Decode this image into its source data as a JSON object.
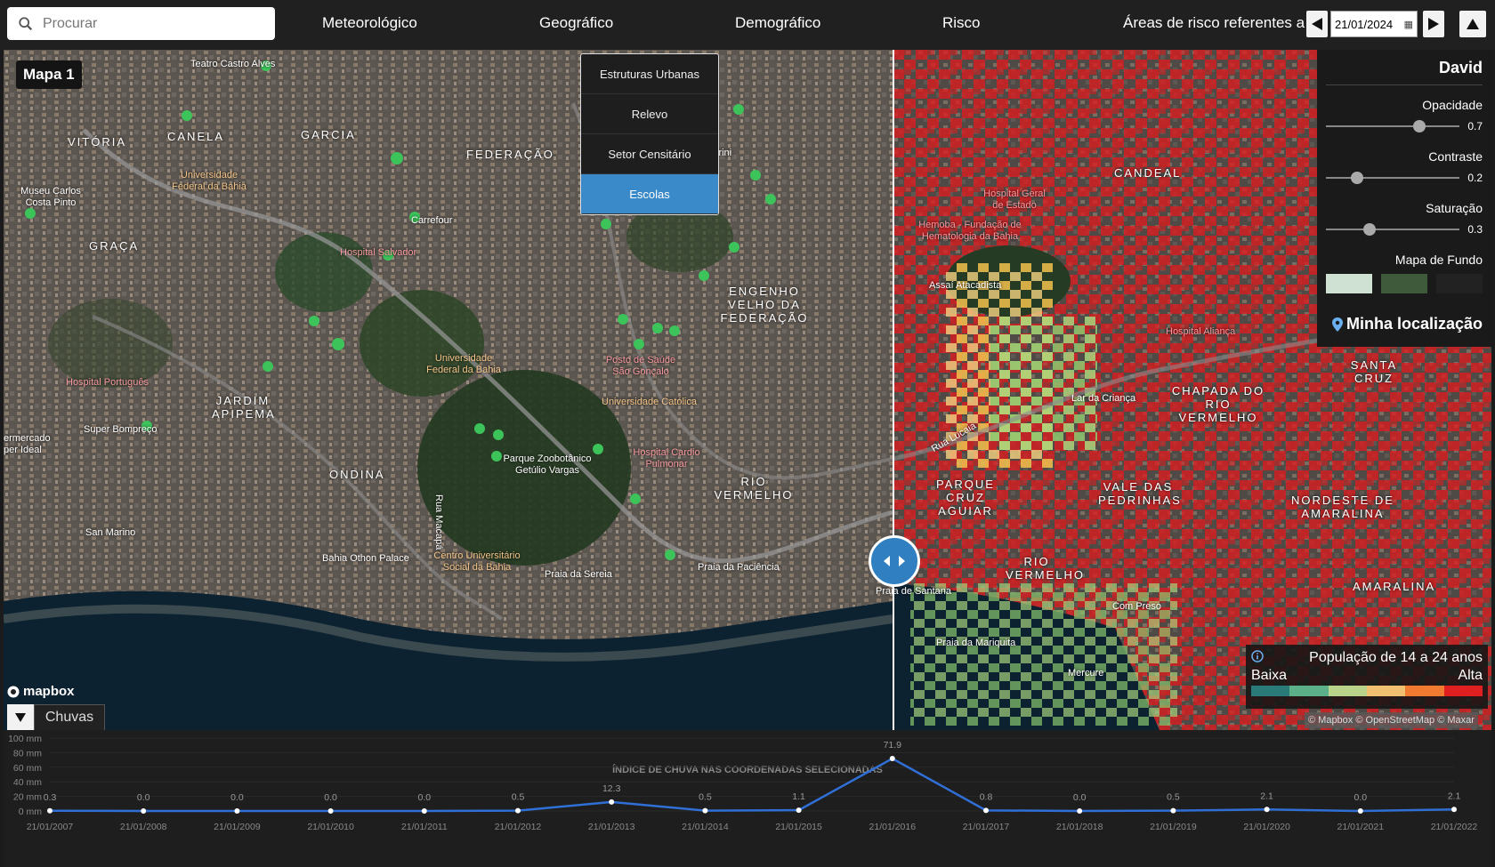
{
  "search": {
    "placeholder": "Procurar"
  },
  "nav": [
    "Meteorológico",
    "Geográfico",
    "Demográfico",
    "Risco"
  ],
  "risk": {
    "label": "Áreas de risco referentes a",
    "date": "21/01/2024"
  },
  "dropdown": {
    "options": [
      "Estruturas Urbanas",
      "Relevo",
      "Setor Censitário",
      "Escolas"
    ],
    "selected": "Escolas"
  },
  "map": {
    "title": "Mapa 1",
    "attribution": "© Mapbox © OpenStreetMap © Maxar",
    "brand": "mapbox",
    "labels_left": [
      "VITÓRIA",
      "CANELA",
      "GARCIA",
      "FEDERAÇÃO",
      "GRAÇA",
      "ENGENHO VELHO DA FEDERAÇÃO",
      "JARDIM APIPEMA",
      "ONDINA",
      "RIO VERMELHO",
      "Teatro Castro Alves",
      "Universidade Federal da Bahia",
      "Museu Carlos Costa Pinto",
      "Carrefour",
      "Hospital Salvador",
      "Perini",
      "Hospital Português",
      "Super Bompreço",
      "ermercado per Ideal",
      "San Marino",
      "Universidade Federal da Bahia",
      "Posto de Saúde São Gonçalo",
      "Universidade Católica",
      "Parque Zoobotânico Getúlio Vargas",
      "Hospital Cardio Pulmonar",
      "Bahia Othon Palace",
      "Centro Universitário Social da Bahia",
      "Praia da Sereia",
      "Praia da Paciência",
      "Rua Macapá"
    ],
    "labels_right": [
      "CANDEAL",
      "Hospital Geral de Estado",
      "Hemoba - Fundação de Hematologia da Bahia",
      "Assaí Atacadista",
      "Hospital Aliança",
      "SANTA CRUZ",
      "CHAPADA DO RIO VERMELHO",
      "Lar da Criança",
      "PARQUE CRUZ AGUIAR",
      "VALE DAS PEDRINHAS",
      "NORDESTE DE AMARALINA",
      "RIO VERMELHO",
      "AMARALINA",
      "Praia de Santana",
      "Com Preso",
      "Praia da Mariquita",
      "Mercure",
      "Rua Lucaia"
    ]
  },
  "panel": {
    "user": "David",
    "opacity": {
      "label": "Opacidade",
      "value": 0.7
    },
    "contrast": {
      "label": "Contraste",
      "value": 0.2
    },
    "saturation": {
      "label": "Saturação",
      "value": 0.3
    },
    "basemap_label": "Mapa de Fundo",
    "location_label": "Minha localização"
  },
  "legend": {
    "title": "População de 14 a 24 anos",
    "low": "Baixa",
    "high": "Alta",
    "colors": [
      "#2b7a7a",
      "#5bb08a",
      "#b9d48a",
      "#f0c070",
      "#f07b30",
      "#e02020"
    ]
  },
  "chuvas_tab": "Chuvas",
  "chart_data": {
    "type": "line",
    "title": "ÍNDICE DE CHUVA NAS COORDENADAS SELECIONADAS",
    "x": [
      "21/01/2007",
      "21/01/2008",
      "21/01/2009",
      "21/01/2010",
      "21/01/2011",
      "21/01/2012",
      "21/01/2013",
      "21/01/2014",
      "21/01/2015",
      "21/01/2016",
      "21/01/2017",
      "21/01/2018",
      "21/01/2019",
      "21/01/2020",
      "21/01/2021",
      "21/01/2022"
    ],
    "values": [
      0.3,
      0.0,
      0.0,
      0.0,
      0.0,
      0.5,
      12.3,
      0.5,
      1.1,
      71.9,
      0.8,
      0.0,
      0.5,
      2.1,
      0.0,
      2.1
    ],
    "yticks": [
      "0 mm",
      "20 mm",
      "40 mm",
      "60 mm",
      "80 mm",
      "100 mm"
    ],
    "ylim": [
      0,
      100
    ],
    "color": "#2f6fd6"
  }
}
